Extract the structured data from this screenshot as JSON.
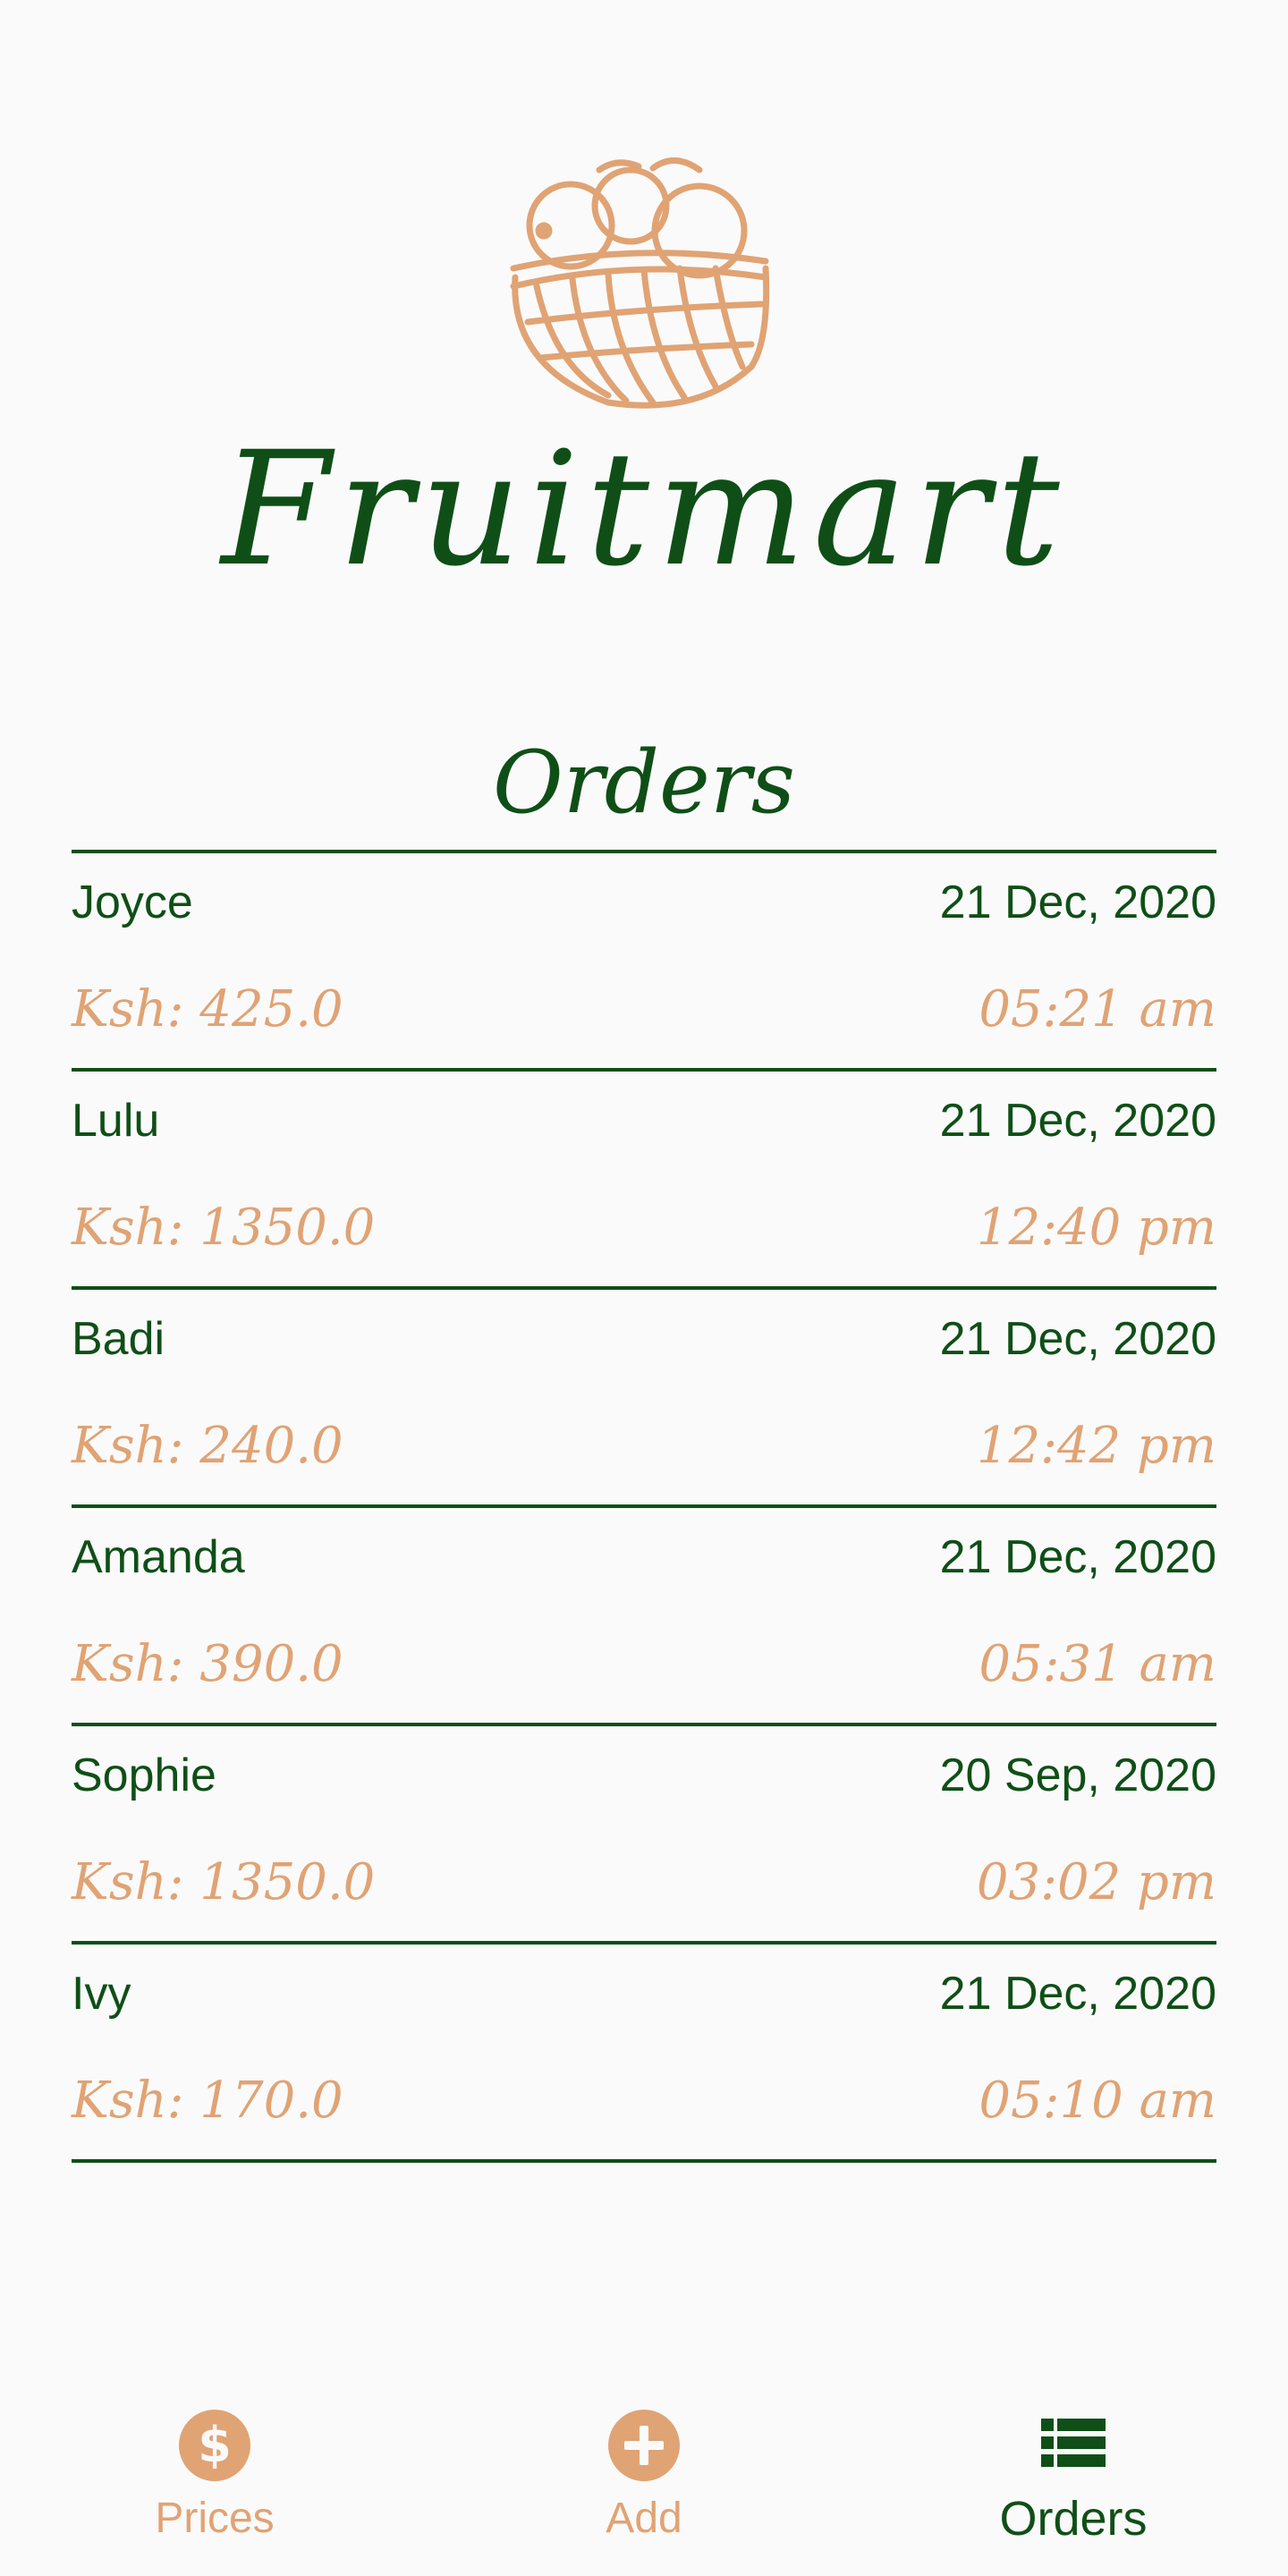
{
  "app": {
    "name": "Fruitmart"
  },
  "page": {
    "title": "Orders"
  },
  "colors": {
    "primary_green": "#0f4f17",
    "accent_peach": "#e0a374",
    "background": "#fafafa"
  },
  "orders": [
    {
      "customer": "Joyce",
      "date": "21 Dec, 2020",
      "amount": "Ksh: 425.0",
      "time": "05:21 am"
    },
    {
      "customer": "Lulu",
      "date": "21 Dec, 2020",
      "amount": "Ksh: 1350.0",
      "time": "12:40 pm"
    },
    {
      "customer": "Badi",
      "date": "21 Dec, 2020",
      "amount": "Ksh: 240.0",
      "time": "12:42 pm"
    },
    {
      "customer": "Amanda",
      "date": "21 Dec, 2020",
      "amount": "Ksh: 390.0",
      "time": "05:31 am"
    },
    {
      "customer": "Sophie",
      "date": "20 Sep, 2020",
      "amount": "Ksh: 1350.0",
      "time": "03:02 pm"
    },
    {
      "customer": "Ivy",
      "date": "21 Dec, 2020",
      "amount": "Ksh: 170.0",
      "time": "05:10 am"
    }
  ],
  "bottom_nav": {
    "items": [
      {
        "label": "Prices",
        "icon": "dollar-circle-icon",
        "active": false
      },
      {
        "label": "Add",
        "icon": "plus-circle-icon",
        "active": false
      },
      {
        "label": "Orders",
        "icon": "list-icon",
        "active": true
      }
    ]
  }
}
